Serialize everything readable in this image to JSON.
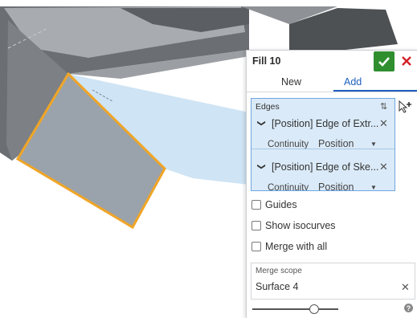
{
  "dialog": {
    "title": "Fill 10",
    "ok_icon": "checkmark-icon",
    "cancel_icon": "close-icon",
    "colors": {
      "accept": "#2f8f2f",
      "cancel": "#d3242b",
      "accent": "#1f5fbf",
      "selection": "#daeaf8",
      "highlight_edge": "#f0a526"
    }
  },
  "tabs": [
    {
      "label": "New",
      "active": false
    },
    {
      "label": "Add",
      "active": true
    }
  ],
  "edges": {
    "label": "Edges",
    "items": [
      {
        "name": "[Position] Edge of Extr...",
        "continuity_label": "Continuity",
        "continuity_value": "Position"
      },
      {
        "name": "[Position] Edge of Ske...",
        "continuity_label": "Continuity",
        "continuity_value": "Position"
      }
    ]
  },
  "options": [
    {
      "label": "Guides",
      "checked": false
    },
    {
      "label": "Show isocurves",
      "checked": false
    },
    {
      "label": "Merge with all",
      "checked": false
    }
  ],
  "merge_scope": {
    "label": "Merge scope",
    "value": "Surface 4"
  },
  "slider": {
    "level": 0.72
  },
  "help_icon": "?"
}
